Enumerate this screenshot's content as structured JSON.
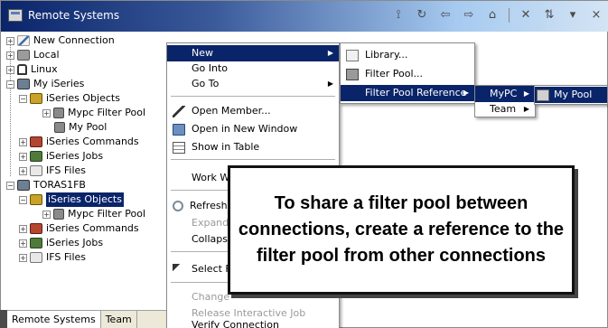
{
  "window": {
    "title": "Remote Systems",
    "toolbar_icons": [
      "new-connection-icon",
      "refresh-icon",
      "back-icon",
      "forward-icon",
      "home-icon",
      "collapse-icon",
      "link-icon",
      "menu-dropdown-icon",
      "close-icon"
    ]
  },
  "tree": {
    "items": [
      {
        "label": "New Connection",
        "icon": "new-connection-icon",
        "expander": "+"
      },
      {
        "label": "Local",
        "icon": "local-system-icon",
        "expander": "+"
      },
      {
        "label": "Linux",
        "icon": "linux-icon",
        "expander": "+"
      },
      {
        "label": "My iSeries",
        "icon": "iseries-system-icon",
        "expander": "−"
      },
      {
        "label": "iSeries Objects",
        "icon": "iseries-objects-icon",
        "expander": "−"
      },
      {
        "label": "Mypc Filter Pool",
        "icon": "filter-pool-icon",
        "expander": "+"
      },
      {
        "label": "My Pool",
        "icon": "filter-pool-icon",
        "expander": ""
      },
      {
        "label": "iSeries Commands",
        "icon": "iseries-commands-icon",
        "expander": "+"
      },
      {
        "label": "iSeries Jobs",
        "icon": "iseries-jobs-icon",
        "expander": "+"
      },
      {
        "label": "IFS Files",
        "icon": "ifs-files-icon",
        "expander": "+"
      },
      {
        "label": "TORAS1FB",
        "icon": "iseries-system-icon",
        "expander": "−"
      },
      {
        "label": "iSeries Objects",
        "icon": "iseries-objects-icon",
        "expander": "−",
        "selected": true
      },
      {
        "label": "Mypc Filter Pool",
        "icon": "filter-pool-icon",
        "expander": "+"
      },
      {
        "label": "iSeries Commands",
        "icon": "iseries-commands-icon",
        "expander": "+"
      },
      {
        "label": "iSeries Jobs",
        "icon": "iseries-jobs-icon",
        "expander": "+"
      },
      {
        "label": "IFS Files",
        "icon": "ifs-files-icon",
        "expander": "+"
      }
    ]
  },
  "context_menu": {
    "items": [
      {
        "label": "New",
        "highlighted": true,
        "submenu": true
      },
      {
        "label": "Go Into"
      },
      {
        "label": "Go To",
        "submenu": true
      },
      {
        "label": "Open Member...",
        "icon": "pencil-icon"
      },
      {
        "label": "Open in New Window",
        "icon": "new-window-icon"
      },
      {
        "label": "Show in Table",
        "icon": "table-icon"
      },
      {
        "label": "Work W"
      },
      {
        "label": "Refresh",
        "icon": "refresh-icon"
      },
      {
        "label": "Expand",
        "disabled": true
      },
      {
        "label": "Collapse"
      },
      {
        "label": "Select F",
        "icon": "select-icon"
      },
      {
        "label": "Change",
        "disabled": true
      },
      {
        "label": "Release Interactive Job",
        "disabled": true
      },
      {
        "label": "Verify Connection"
      }
    ]
  },
  "submenu_new": {
    "items": [
      {
        "label": "Library...",
        "icon": "library-icon"
      },
      {
        "label": "Filter Pool...",
        "icon": "filter-pool-icon"
      },
      {
        "label": "Filter Pool Reference",
        "highlighted": true,
        "submenu": true
      }
    ]
  },
  "submenu_reference": {
    "items": [
      {
        "label": "MyPC",
        "highlighted": true,
        "submenu": true
      },
      {
        "label": "Team",
        "submenu": true
      }
    ]
  },
  "submenu_mypc": {
    "items": [
      {
        "label": "My Pool",
        "highlighted": true,
        "icon": "filter-pool-icon"
      }
    ]
  },
  "tabs": [
    "Remote Systems",
    "Team"
  ],
  "callout": {
    "text": "To share a filter pool between connections, create a reference to the filter pool from other connections"
  },
  "colors": {
    "selection": "#0a246a",
    "title_gradient_start": "#0a246a",
    "title_gradient_end": "#d4e4f4"
  }
}
